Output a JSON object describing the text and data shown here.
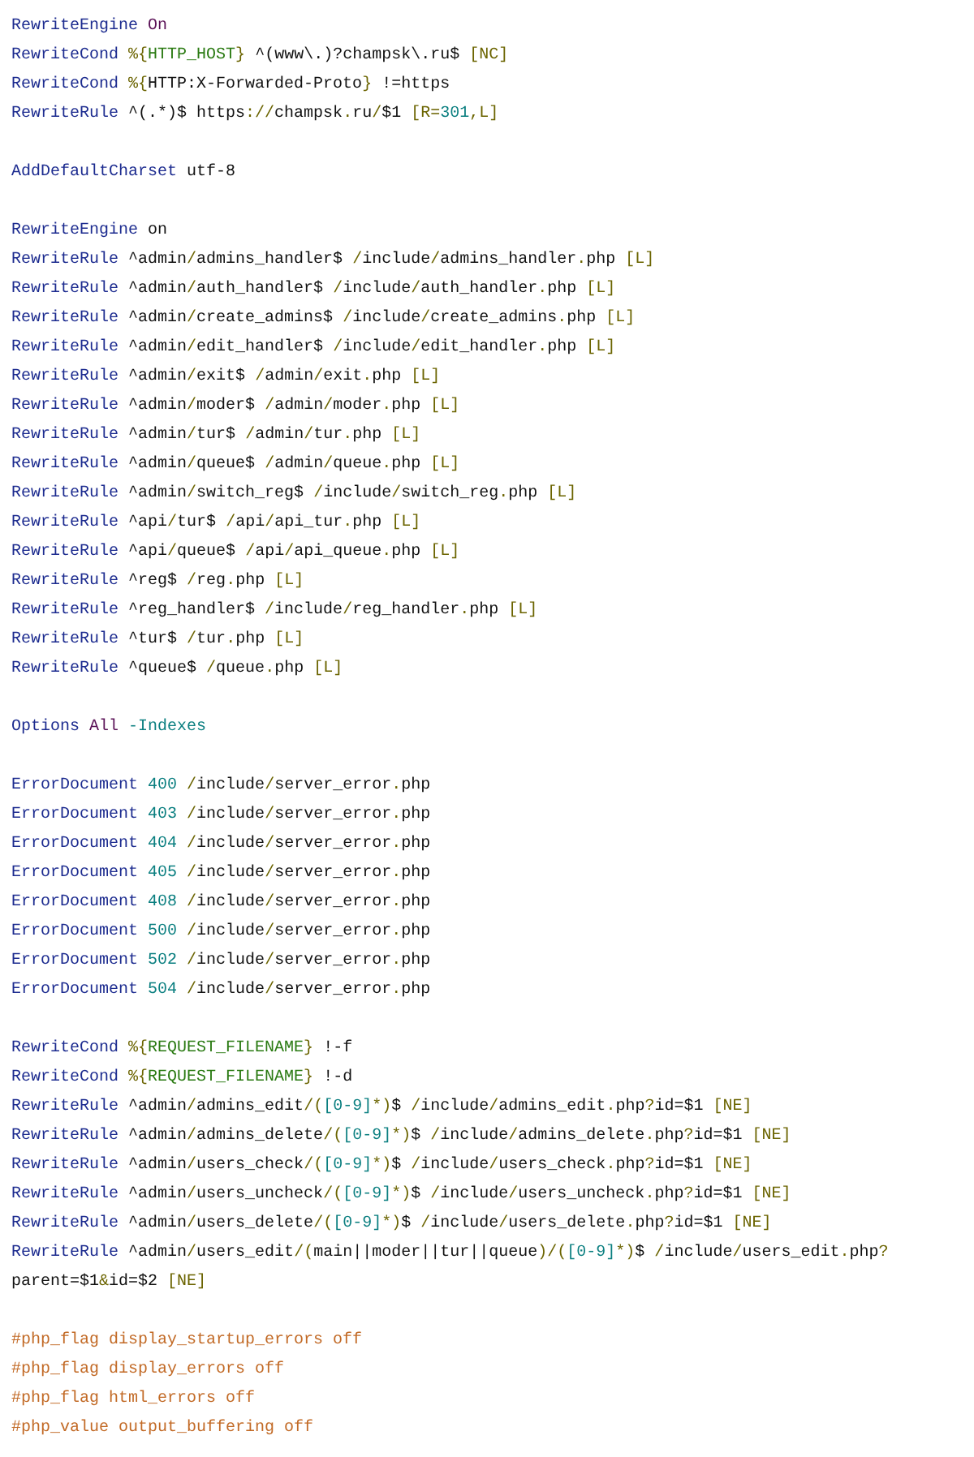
{
  "lines": [
    {
      "kind": "code",
      "tokens": [
        {
          "text": "RewriteEngine",
          "kind": "d"
        },
        {
          "text": " On",
          "kind": "k"
        }
      ]
    },
    {
      "kind": "code",
      "tokens": [
        {
          "text": "RewriteCond",
          "kind": "d"
        },
        {
          "text": " %{",
          "kind": "p"
        },
        {
          "text": "HTTP_HOST",
          "kind": "v"
        },
        {
          "text": "}",
          "kind": "p"
        },
        {
          "text": " ^(www\\.)?champsk\\.ru$ ",
          "kind": "t"
        },
        {
          "text": "[NC]",
          "kind": "p"
        }
      ]
    },
    {
      "kind": "code",
      "tokens": [
        {
          "text": "RewriteCond",
          "kind": "d"
        },
        {
          "text": " %{",
          "kind": "p"
        },
        {
          "text": "HTTP:X-Forwarded-Proto",
          "kind": "t"
        },
        {
          "text": "}",
          "kind": "p"
        },
        {
          "text": " !=https",
          "kind": "t"
        }
      ]
    },
    {
      "kind": "code",
      "tokens": [
        {
          "text": "RewriteRule",
          "kind": "d"
        },
        {
          "text": " ^(.*)$ https",
          "kind": "t"
        },
        {
          "text": "://",
          "kind": "p"
        },
        {
          "text": "champsk",
          "kind": "t"
        },
        {
          "text": ".",
          "kind": "p"
        },
        {
          "text": "ru",
          "kind": "t"
        },
        {
          "text": "/",
          "kind": "p"
        },
        {
          "text": "$1 ",
          "kind": "t"
        },
        {
          "text": "[R=",
          "kind": "p"
        },
        {
          "text": "301",
          "kind": "n"
        },
        {
          "text": ",L]",
          "kind": "p"
        }
      ]
    },
    {
      "kind": "blank"
    },
    {
      "kind": "code",
      "tokens": [
        {
          "text": "AddDefaultCharset",
          "kind": "d"
        },
        {
          "text": " utf-8",
          "kind": "t"
        }
      ]
    },
    {
      "kind": "blank"
    },
    {
      "kind": "code",
      "tokens": [
        {
          "text": "RewriteEngine",
          "kind": "d"
        },
        {
          "text": " on",
          "kind": "t"
        }
      ]
    },
    {
      "kind": "code",
      "tokens": [
        {
          "text": "RewriteRule",
          "kind": "d"
        },
        {
          "text": " ^admin",
          "kind": "t"
        },
        {
          "text": "/",
          "kind": "p"
        },
        {
          "text": "admins_handler$ ",
          "kind": "t"
        },
        {
          "text": "/",
          "kind": "p"
        },
        {
          "text": "include",
          "kind": "t"
        },
        {
          "text": "/",
          "kind": "p"
        },
        {
          "text": "admins_handler",
          "kind": "t"
        },
        {
          "text": ".",
          "kind": "p"
        },
        {
          "text": "php ",
          "kind": "t"
        },
        {
          "text": "[L]",
          "kind": "p"
        }
      ]
    },
    {
      "kind": "code",
      "tokens": [
        {
          "text": "RewriteRule",
          "kind": "d"
        },
        {
          "text": " ^admin",
          "kind": "t"
        },
        {
          "text": "/",
          "kind": "p"
        },
        {
          "text": "auth_handler$ ",
          "kind": "t"
        },
        {
          "text": "/",
          "kind": "p"
        },
        {
          "text": "include",
          "kind": "t"
        },
        {
          "text": "/",
          "kind": "p"
        },
        {
          "text": "auth_handler",
          "kind": "t"
        },
        {
          "text": ".",
          "kind": "p"
        },
        {
          "text": "php ",
          "kind": "t"
        },
        {
          "text": "[L]",
          "kind": "p"
        }
      ]
    },
    {
      "kind": "code",
      "tokens": [
        {
          "text": "RewriteRule",
          "kind": "d"
        },
        {
          "text": " ^admin",
          "kind": "t"
        },
        {
          "text": "/",
          "kind": "p"
        },
        {
          "text": "create_admins$ ",
          "kind": "t"
        },
        {
          "text": "/",
          "kind": "p"
        },
        {
          "text": "include",
          "kind": "t"
        },
        {
          "text": "/",
          "kind": "p"
        },
        {
          "text": "create_admins",
          "kind": "t"
        },
        {
          "text": ".",
          "kind": "p"
        },
        {
          "text": "php ",
          "kind": "t"
        },
        {
          "text": "[L]",
          "kind": "p"
        }
      ]
    },
    {
      "kind": "code",
      "tokens": [
        {
          "text": "RewriteRule",
          "kind": "d"
        },
        {
          "text": " ^admin",
          "kind": "t"
        },
        {
          "text": "/",
          "kind": "p"
        },
        {
          "text": "edit_handler$ ",
          "kind": "t"
        },
        {
          "text": "/",
          "kind": "p"
        },
        {
          "text": "include",
          "kind": "t"
        },
        {
          "text": "/",
          "kind": "p"
        },
        {
          "text": "edit_handler",
          "kind": "t"
        },
        {
          "text": ".",
          "kind": "p"
        },
        {
          "text": "php ",
          "kind": "t"
        },
        {
          "text": "[L]",
          "kind": "p"
        }
      ]
    },
    {
      "kind": "code",
      "tokens": [
        {
          "text": "RewriteRule",
          "kind": "d"
        },
        {
          "text": " ^admin",
          "kind": "t"
        },
        {
          "text": "/",
          "kind": "p"
        },
        {
          "text": "exit$ ",
          "kind": "t"
        },
        {
          "text": "/",
          "kind": "p"
        },
        {
          "text": "admin",
          "kind": "t"
        },
        {
          "text": "/",
          "kind": "p"
        },
        {
          "text": "exit",
          "kind": "t"
        },
        {
          "text": ".",
          "kind": "p"
        },
        {
          "text": "php ",
          "kind": "t"
        },
        {
          "text": "[L]",
          "kind": "p"
        }
      ]
    },
    {
      "kind": "code",
      "tokens": [
        {
          "text": "RewriteRule",
          "kind": "d"
        },
        {
          "text": " ^admin",
          "kind": "t"
        },
        {
          "text": "/",
          "kind": "p"
        },
        {
          "text": "moder$ ",
          "kind": "t"
        },
        {
          "text": "/",
          "kind": "p"
        },
        {
          "text": "admin",
          "kind": "t"
        },
        {
          "text": "/",
          "kind": "p"
        },
        {
          "text": "moder",
          "kind": "t"
        },
        {
          "text": ".",
          "kind": "p"
        },
        {
          "text": "php ",
          "kind": "t"
        },
        {
          "text": "[L]",
          "kind": "p"
        }
      ]
    },
    {
      "kind": "code",
      "tokens": [
        {
          "text": "RewriteRule",
          "kind": "d"
        },
        {
          "text": " ^admin",
          "kind": "t"
        },
        {
          "text": "/",
          "kind": "p"
        },
        {
          "text": "tur$ ",
          "kind": "t"
        },
        {
          "text": "/",
          "kind": "p"
        },
        {
          "text": "admin",
          "kind": "t"
        },
        {
          "text": "/",
          "kind": "p"
        },
        {
          "text": "tur",
          "kind": "t"
        },
        {
          "text": ".",
          "kind": "p"
        },
        {
          "text": "php ",
          "kind": "t"
        },
        {
          "text": "[L]",
          "kind": "p"
        }
      ]
    },
    {
      "kind": "code",
      "tokens": [
        {
          "text": "RewriteRule",
          "kind": "d"
        },
        {
          "text": " ^admin",
          "kind": "t"
        },
        {
          "text": "/",
          "kind": "p"
        },
        {
          "text": "queue$ ",
          "kind": "t"
        },
        {
          "text": "/",
          "kind": "p"
        },
        {
          "text": "admin",
          "kind": "t"
        },
        {
          "text": "/",
          "kind": "p"
        },
        {
          "text": "queue",
          "kind": "t"
        },
        {
          "text": ".",
          "kind": "p"
        },
        {
          "text": "php ",
          "kind": "t"
        },
        {
          "text": "[L]",
          "kind": "p"
        }
      ]
    },
    {
      "kind": "code",
      "tokens": [
        {
          "text": "RewriteRule",
          "kind": "d"
        },
        {
          "text": " ^admin",
          "kind": "t"
        },
        {
          "text": "/",
          "kind": "p"
        },
        {
          "text": "switch_reg$ ",
          "kind": "t"
        },
        {
          "text": "/",
          "kind": "p"
        },
        {
          "text": "include",
          "kind": "t"
        },
        {
          "text": "/",
          "kind": "p"
        },
        {
          "text": "switch_reg",
          "kind": "t"
        },
        {
          "text": ".",
          "kind": "p"
        },
        {
          "text": "php ",
          "kind": "t"
        },
        {
          "text": "[L]",
          "kind": "p"
        }
      ]
    },
    {
      "kind": "code",
      "tokens": [
        {
          "text": "RewriteRule",
          "kind": "d"
        },
        {
          "text": " ^api",
          "kind": "t"
        },
        {
          "text": "/",
          "kind": "p"
        },
        {
          "text": "tur$ ",
          "kind": "t"
        },
        {
          "text": "/",
          "kind": "p"
        },
        {
          "text": "api",
          "kind": "t"
        },
        {
          "text": "/",
          "kind": "p"
        },
        {
          "text": "api_tur",
          "kind": "t"
        },
        {
          "text": ".",
          "kind": "p"
        },
        {
          "text": "php ",
          "kind": "t"
        },
        {
          "text": "[L]",
          "kind": "p"
        }
      ]
    },
    {
      "kind": "code",
      "tokens": [
        {
          "text": "RewriteRule",
          "kind": "d"
        },
        {
          "text": " ^api",
          "kind": "t"
        },
        {
          "text": "/",
          "kind": "p"
        },
        {
          "text": "queue$ ",
          "kind": "t"
        },
        {
          "text": "/",
          "kind": "p"
        },
        {
          "text": "api",
          "kind": "t"
        },
        {
          "text": "/",
          "kind": "p"
        },
        {
          "text": "api_queue",
          "kind": "t"
        },
        {
          "text": ".",
          "kind": "p"
        },
        {
          "text": "php ",
          "kind": "t"
        },
        {
          "text": "[L]",
          "kind": "p"
        }
      ]
    },
    {
      "kind": "code",
      "tokens": [
        {
          "text": "RewriteRule",
          "kind": "d"
        },
        {
          "text": " ^reg$ ",
          "kind": "t"
        },
        {
          "text": "/",
          "kind": "p"
        },
        {
          "text": "reg",
          "kind": "t"
        },
        {
          "text": ".",
          "kind": "p"
        },
        {
          "text": "php ",
          "kind": "t"
        },
        {
          "text": "[L]",
          "kind": "p"
        }
      ]
    },
    {
      "kind": "code",
      "tokens": [
        {
          "text": "RewriteRule",
          "kind": "d"
        },
        {
          "text": " ^reg_handler$ ",
          "kind": "t"
        },
        {
          "text": "/",
          "kind": "p"
        },
        {
          "text": "include",
          "kind": "t"
        },
        {
          "text": "/",
          "kind": "p"
        },
        {
          "text": "reg_handler",
          "kind": "t"
        },
        {
          "text": ".",
          "kind": "p"
        },
        {
          "text": "php ",
          "kind": "t"
        },
        {
          "text": "[L]",
          "kind": "p"
        }
      ]
    },
    {
      "kind": "code",
      "tokens": [
        {
          "text": "RewriteRule",
          "kind": "d"
        },
        {
          "text": " ^tur$ ",
          "kind": "t"
        },
        {
          "text": "/",
          "kind": "p"
        },
        {
          "text": "tur",
          "kind": "t"
        },
        {
          "text": ".",
          "kind": "p"
        },
        {
          "text": "php ",
          "kind": "t"
        },
        {
          "text": "[L]",
          "kind": "p"
        }
      ]
    },
    {
      "kind": "code",
      "tokens": [
        {
          "text": "RewriteRule",
          "kind": "d"
        },
        {
          "text": " ^queue$ ",
          "kind": "t"
        },
        {
          "text": "/",
          "kind": "p"
        },
        {
          "text": "queue",
          "kind": "t"
        },
        {
          "text": ".",
          "kind": "p"
        },
        {
          "text": "php ",
          "kind": "t"
        },
        {
          "text": "[L]",
          "kind": "p"
        }
      ]
    },
    {
      "kind": "blank"
    },
    {
      "kind": "code",
      "tokens": [
        {
          "text": "Options",
          "kind": "d"
        },
        {
          "text": " All",
          "kind": "k"
        },
        {
          "text": " -Indexes",
          "kind": "n"
        }
      ]
    },
    {
      "kind": "blank"
    },
    {
      "kind": "code",
      "tokens": [
        {
          "text": "ErrorDocument",
          "kind": "d"
        },
        {
          "text": " 400",
          "kind": "n"
        },
        {
          "text": " /",
          "kind": "p"
        },
        {
          "text": "include",
          "kind": "t"
        },
        {
          "text": "/",
          "kind": "p"
        },
        {
          "text": "server_error",
          "kind": "t"
        },
        {
          "text": ".",
          "kind": "p"
        },
        {
          "text": "php",
          "kind": "t"
        }
      ]
    },
    {
      "kind": "code",
      "tokens": [
        {
          "text": "ErrorDocument",
          "kind": "d"
        },
        {
          "text": " 403",
          "kind": "n"
        },
        {
          "text": " /",
          "kind": "p"
        },
        {
          "text": "include",
          "kind": "t"
        },
        {
          "text": "/",
          "kind": "p"
        },
        {
          "text": "server_error",
          "kind": "t"
        },
        {
          "text": ".",
          "kind": "p"
        },
        {
          "text": "php",
          "kind": "t"
        }
      ]
    },
    {
      "kind": "code",
      "tokens": [
        {
          "text": "ErrorDocument",
          "kind": "d"
        },
        {
          "text": " 404",
          "kind": "n"
        },
        {
          "text": " /",
          "kind": "p"
        },
        {
          "text": "include",
          "kind": "t"
        },
        {
          "text": "/",
          "kind": "p"
        },
        {
          "text": "server_error",
          "kind": "t"
        },
        {
          "text": ".",
          "kind": "p"
        },
        {
          "text": "php",
          "kind": "t"
        }
      ]
    },
    {
      "kind": "code",
      "tokens": [
        {
          "text": "ErrorDocument",
          "kind": "d"
        },
        {
          "text": " 405",
          "kind": "n"
        },
        {
          "text": " /",
          "kind": "p"
        },
        {
          "text": "include",
          "kind": "t"
        },
        {
          "text": "/",
          "kind": "p"
        },
        {
          "text": "server_error",
          "kind": "t"
        },
        {
          "text": ".",
          "kind": "p"
        },
        {
          "text": "php",
          "kind": "t"
        }
      ]
    },
    {
      "kind": "code",
      "tokens": [
        {
          "text": "ErrorDocument",
          "kind": "d"
        },
        {
          "text": " 408",
          "kind": "n"
        },
        {
          "text": " /",
          "kind": "p"
        },
        {
          "text": "include",
          "kind": "t"
        },
        {
          "text": "/",
          "kind": "p"
        },
        {
          "text": "server_error",
          "kind": "t"
        },
        {
          "text": ".",
          "kind": "p"
        },
        {
          "text": "php",
          "kind": "t"
        }
      ]
    },
    {
      "kind": "code",
      "tokens": [
        {
          "text": "ErrorDocument",
          "kind": "d"
        },
        {
          "text": " 500",
          "kind": "n"
        },
        {
          "text": " /",
          "kind": "p"
        },
        {
          "text": "include",
          "kind": "t"
        },
        {
          "text": "/",
          "kind": "p"
        },
        {
          "text": "server_error",
          "kind": "t"
        },
        {
          "text": ".",
          "kind": "p"
        },
        {
          "text": "php",
          "kind": "t"
        }
      ]
    },
    {
      "kind": "code",
      "tokens": [
        {
          "text": "ErrorDocument",
          "kind": "d"
        },
        {
          "text": " 502",
          "kind": "n"
        },
        {
          "text": " /",
          "kind": "p"
        },
        {
          "text": "include",
          "kind": "t"
        },
        {
          "text": "/",
          "kind": "p"
        },
        {
          "text": "server_error",
          "kind": "t"
        },
        {
          "text": ".",
          "kind": "p"
        },
        {
          "text": "php",
          "kind": "t"
        }
      ]
    },
    {
      "kind": "code",
      "tokens": [
        {
          "text": "ErrorDocument",
          "kind": "d"
        },
        {
          "text": " 504",
          "kind": "n"
        },
        {
          "text": " /",
          "kind": "p"
        },
        {
          "text": "include",
          "kind": "t"
        },
        {
          "text": "/",
          "kind": "p"
        },
        {
          "text": "server_error",
          "kind": "t"
        },
        {
          "text": ".",
          "kind": "p"
        },
        {
          "text": "php",
          "kind": "t"
        }
      ]
    },
    {
      "kind": "blank"
    },
    {
      "kind": "code",
      "tokens": [
        {
          "text": "RewriteCond",
          "kind": "d"
        },
        {
          "text": " %{",
          "kind": "p"
        },
        {
          "text": "REQUEST_FILENAME",
          "kind": "v"
        },
        {
          "text": "}",
          "kind": "p"
        },
        {
          "text": " !-f",
          "kind": "t"
        }
      ]
    },
    {
      "kind": "code",
      "tokens": [
        {
          "text": "RewriteCond",
          "kind": "d"
        },
        {
          "text": " %{",
          "kind": "p"
        },
        {
          "text": "REQUEST_FILENAME",
          "kind": "v"
        },
        {
          "text": "}",
          "kind": "p"
        },
        {
          "text": " !-d",
          "kind": "t"
        }
      ]
    },
    {
      "kind": "code",
      "tokens": [
        {
          "text": "RewriteRule",
          "kind": "d"
        },
        {
          "text": " ^admin",
          "kind": "t"
        },
        {
          "text": "/",
          "kind": "p"
        },
        {
          "text": "admins_edit",
          "kind": "t"
        },
        {
          "text": "/(",
          "kind": "p"
        },
        {
          "text": "[0-9]",
          "kind": "n"
        },
        {
          "text": "*)",
          "kind": "p"
        },
        {
          "text": "$ ",
          "kind": "t"
        },
        {
          "text": "/",
          "kind": "p"
        },
        {
          "text": "include",
          "kind": "t"
        },
        {
          "text": "/",
          "kind": "p"
        },
        {
          "text": "admins_edit",
          "kind": "t"
        },
        {
          "text": ".",
          "kind": "p"
        },
        {
          "text": "php",
          "kind": "t"
        },
        {
          "text": "?",
          "kind": "p"
        },
        {
          "text": "id=$1 ",
          "kind": "t"
        },
        {
          "text": "[NE]",
          "kind": "p"
        }
      ]
    },
    {
      "kind": "code",
      "tokens": [
        {
          "text": "RewriteRule",
          "kind": "d"
        },
        {
          "text": " ^admin",
          "kind": "t"
        },
        {
          "text": "/",
          "kind": "p"
        },
        {
          "text": "admins_delete",
          "kind": "t"
        },
        {
          "text": "/(",
          "kind": "p"
        },
        {
          "text": "[0-9]",
          "kind": "n"
        },
        {
          "text": "*)",
          "kind": "p"
        },
        {
          "text": "$ ",
          "kind": "t"
        },
        {
          "text": "/",
          "kind": "p"
        },
        {
          "text": "include",
          "kind": "t"
        },
        {
          "text": "/",
          "kind": "p"
        },
        {
          "text": "admins_delete",
          "kind": "t"
        },
        {
          "text": ".",
          "kind": "p"
        },
        {
          "text": "php",
          "kind": "t"
        },
        {
          "text": "?",
          "kind": "p"
        },
        {
          "text": "id=$1 ",
          "kind": "t"
        },
        {
          "text": "[NE]",
          "kind": "p"
        }
      ]
    },
    {
      "kind": "code",
      "tokens": [
        {
          "text": "RewriteRule",
          "kind": "d"
        },
        {
          "text": " ^admin",
          "kind": "t"
        },
        {
          "text": "/",
          "kind": "p"
        },
        {
          "text": "users_check",
          "kind": "t"
        },
        {
          "text": "/(",
          "kind": "p"
        },
        {
          "text": "[0-9]",
          "kind": "n"
        },
        {
          "text": "*)",
          "kind": "p"
        },
        {
          "text": "$ ",
          "kind": "t"
        },
        {
          "text": "/",
          "kind": "p"
        },
        {
          "text": "include",
          "kind": "t"
        },
        {
          "text": "/",
          "kind": "p"
        },
        {
          "text": "users_check",
          "kind": "t"
        },
        {
          "text": ".",
          "kind": "p"
        },
        {
          "text": "php",
          "kind": "t"
        },
        {
          "text": "?",
          "kind": "p"
        },
        {
          "text": "id=$1 ",
          "kind": "t"
        },
        {
          "text": "[NE]",
          "kind": "p"
        }
      ]
    },
    {
      "kind": "code",
      "tokens": [
        {
          "text": "RewriteRule",
          "kind": "d"
        },
        {
          "text": " ^admin",
          "kind": "t"
        },
        {
          "text": "/",
          "kind": "p"
        },
        {
          "text": "users_uncheck",
          "kind": "t"
        },
        {
          "text": "/(",
          "kind": "p"
        },
        {
          "text": "[0-9]",
          "kind": "n"
        },
        {
          "text": "*)",
          "kind": "p"
        },
        {
          "text": "$ ",
          "kind": "t"
        },
        {
          "text": "/",
          "kind": "p"
        },
        {
          "text": "include",
          "kind": "t"
        },
        {
          "text": "/",
          "kind": "p"
        },
        {
          "text": "users_uncheck",
          "kind": "t"
        },
        {
          "text": ".",
          "kind": "p"
        },
        {
          "text": "php",
          "kind": "t"
        },
        {
          "text": "?",
          "kind": "p"
        },
        {
          "text": "id=$1 ",
          "kind": "t"
        },
        {
          "text": "[NE]",
          "kind": "p"
        }
      ]
    },
    {
      "kind": "code",
      "tokens": [
        {
          "text": "RewriteRule",
          "kind": "d"
        },
        {
          "text": " ^admin",
          "kind": "t"
        },
        {
          "text": "/",
          "kind": "p"
        },
        {
          "text": "users_delete",
          "kind": "t"
        },
        {
          "text": "/(",
          "kind": "p"
        },
        {
          "text": "[0-9]",
          "kind": "n"
        },
        {
          "text": "*)",
          "kind": "p"
        },
        {
          "text": "$ ",
          "kind": "t"
        },
        {
          "text": "/",
          "kind": "p"
        },
        {
          "text": "include",
          "kind": "t"
        },
        {
          "text": "/",
          "kind": "p"
        },
        {
          "text": "users_delete",
          "kind": "t"
        },
        {
          "text": ".",
          "kind": "p"
        },
        {
          "text": "php",
          "kind": "t"
        },
        {
          "text": "?",
          "kind": "p"
        },
        {
          "text": "id=$1 ",
          "kind": "t"
        },
        {
          "text": "[NE]",
          "kind": "p"
        }
      ]
    },
    {
      "kind": "code",
      "tokens": [
        {
          "text": "RewriteRule",
          "kind": "d"
        },
        {
          "text": " ^admin",
          "kind": "t"
        },
        {
          "text": "/",
          "kind": "p"
        },
        {
          "text": "users_edit",
          "kind": "t"
        },
        {
          "text": "/(",
          "kind": "p"
        },
        {
          "text": "main||moder||tur||queue",
          "kind": "t"
        },
        {
          "text": ")/(",
          "kind": "p"
        },
        {
          "text": "[0-9]",
          "kind": "n"
        },
        {
          "text": "*)",
          "kind": "p"
        },
        {
          "text": "$ ",
          "kind": "t"
        },
        {
          "text": "/",
          "kind": "p"
        },
        {
          "text": "include",
          "kind": "t"
        },
        {
          "text": "/",
          "kind": "p"
        },
        {
          "text": "users_edit",
          "kind": "t"
        },
        {
          "text": ".",
          "kind": "p"
        },
        {
          "text": "php",
          "kind": "t"
        },
        {
          "text": "?",
          "kind": "p"
        }
      ]
    },
    {
      "kind": "code",
      "tokens": [
        {
          "text": "parent=$1",
          "kind": "t"
        },
        {
          "text": "&",
          "kind": "p"
        },
        {
          "text": "id=$2 ",
          "kind": "t"
        },
        {
          "text": "[NE]",
          "kind": "p"
        }
      ]
    },
    {
      "kind": "blank"
    },
    {
      "kind": "code",
      "tokens": [
        {
          "text": "#php_flag display_startup_errors off",
          "kind": "c"
        }
      ]
    },
    {
      "kind": "code",
      "tokens": [
        {
          "text": "#php_flag display_errors off",
          "kind": "c"
        }
      ]
    },
    {
      "kind": "code",
      "tokens": [
        {
          "text": "#php_flag html_errors off",
          "kind": "c"
        }
      ]
    },
    {
      "kind": "code",
      "tokens": [
        {
          "text": "#php_value output_buffering off",
          "kind": "c"
        }
      ]
    }
  ]
}
